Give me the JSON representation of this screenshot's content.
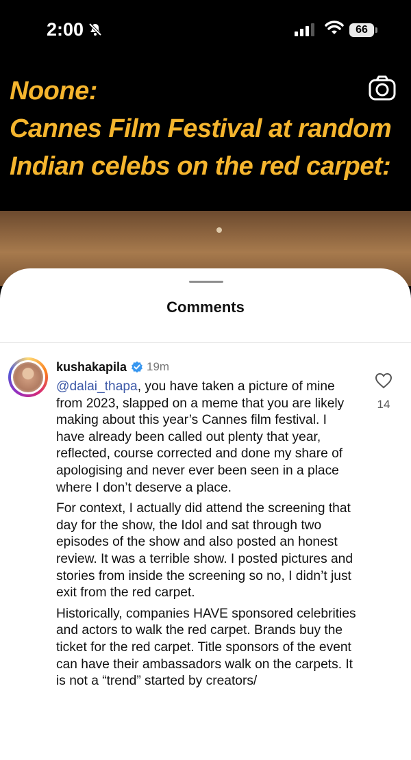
{
  "status": {
    "time": "2:00",
    "battery": "66"
  },
  "meme": {
    "lines": [
      "Noone:",
      "Cannes Film Festival at random",
      "Indian celebs on the red carpet:"
    ]
  },
  "sheet": {
    "title": "Comments"
  },
  "comment": {
    "username": "kushakapila",
    "time_ago": "19m",
    "likes": "14",
    "mention": "@dalai_thapa",
    "paragraph1_rest": ", you have taken a picture of mine from 2023, slapped on a meme that you are likely making about this year’s Cannes film festival. I have already been called out plenty that year, reflected, course corrected and done my share of apologising and never ever been seen in a place where I don’t deserve a place.",
    "paragraph2": "For context, I actually did attend the screening that day for the show, the Idol and sat through two episodes of the show and also posted an honest review. It was a terrible show. I posted pictures and stories from inside the screening so no, I didn’t just exit from the red carpet.",
    "paragraph3": "Historically, companies HAVE sponsored celebrities and actors to walk the red carpet. Brands buy the ticket for the red carpet. Title sponsors of the event can have their ambassadors walk on the carpets. It is not a “trend” started by creators/"
  },
  "icons": {
    "bell": "bell-slash-icon",
    "signal": "cell-signal-icon",
    "wifi": "wifi-icon",
    "battery": "battery-icon",
    "camera": "camera-icon",
    "verified": "verified-badge-icon",
    "heart": "heart-icon"
  },
  "colors": {
    "meme_text": "#f5b52e",
    "mention": "#3e5aa8",
    "verified": "#3897f0"
  }
}
